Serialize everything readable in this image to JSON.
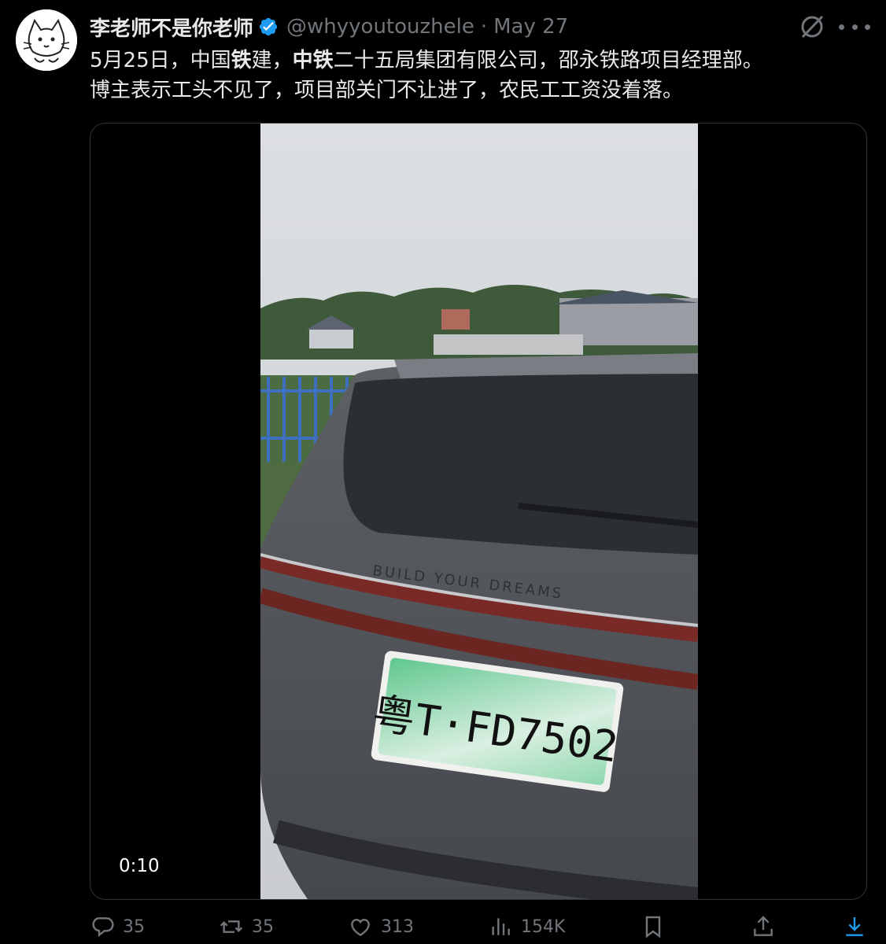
{
  "author": {
    "display_name": "李老师不是你老师",
    "handle": "@whyyoutouzhele",
    "separator": "·",
    "date": "May 27",
    "avatar_icon": "cat-avatar-icon",
    "verified_color": "#1d9bf0"
  },
  "tweet": {
    "line1_a": "5月25日，中国",
    "line1_b": "铁",
    "line1_c": "建，",
    "line1_d": "中铁",
    "line1_e": "二十五局集团有限公司，邵永铁路项目经理部。",
    "line2": "博主表示工头不见了，项目部关门不让进了，农民工工资没着落。"
  },
  "media": {
    "duration": "0:10",
    "car_badge_text": "BUILD YOUR DREAMS",
    "plate_text": "粤T·FD7502"
  },
  "stats": {
    "replies": "35",
    "retweets": "35",
    "likes": "313",
    "views": "154K"
  },
  "colors": {
    "background": "#000000",
    "text": "#e7e9ea",
    "muted": "#71767b",
    "border": "#2f3336"
  }
}
